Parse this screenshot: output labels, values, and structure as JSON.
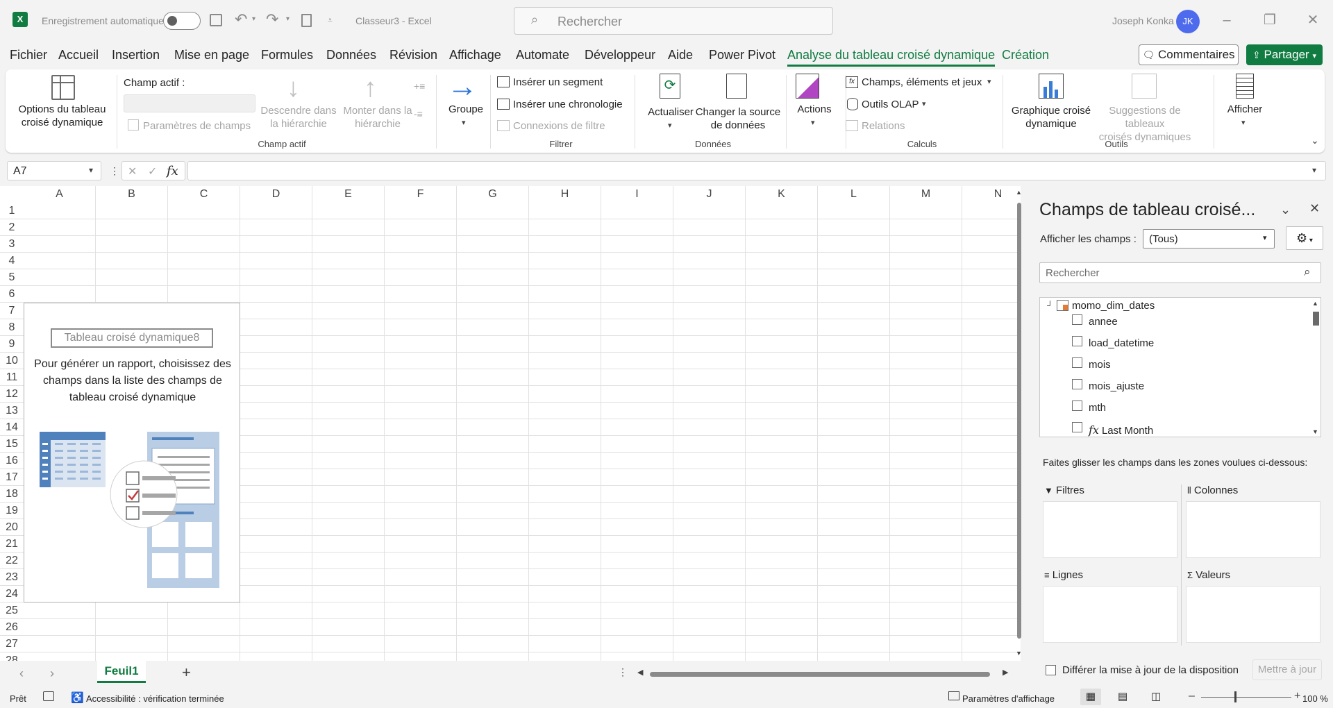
{
  "titlebar": {
    "autosave_label": "Enregistrement automatique",
    "doc_title": "Classeur3  -  Excel",
    "search_placeholder": "Rechercher",
    "user_name": "Joseph Konka",
    "user_initials": "JK"
  },
  "menu": {
    "items": [
      "Fichier",
      "Accueil",
      "Insertion",
      "Mise en page",
      "Formules",
      "Données",
      "Révision",
      "Affichage",
      "Automate",
      "Développeur",
      "Aide",
      "Power Pivot",
      "Analyse du tableau croisé dynamique",
      "Création"
    ],
    "active": "Analyse du tableau croisé dynamique",
    "comments_label": "Commentaires",
    "share_label": "Partager"
  },
  "ribbon": {
    "pivot_options": "Options du tableau\ncroisé dynamique",
    "active_field_label": "Champ actif :",
    "field_settings": "Paramètres de champs",
    "drill_down": "Descendre dans\nla hiérarchie",
    "drill_up": "Monter dans la\nhiérarchie",
    "group_active_field": "Champ actif",
    "group": "Groupe",
    "insert_slicer": "Insérer un segment",
    "insert_timeline": "Insérer une chronologie",
    "filter_connections": "Connexions de filtre",
    "group_filter": "Filtrer",
    "refresh": "Actualiser",
    "change_source": "Changer la source\nde données",
    "group_data": "Données",
    "actions": "Actions",
    "fields_items_sets": "Champs, éléments et jeux",
    "olap_tools": "Outils OLAP",
    "relations": "Relations",
    "group_calculations": "Calculs",
    "pivot_chart": "Graphique croisé\ndynamique",
    "suggestions": "Suggestions de tableaux\ncroisés dynamiques",
    "group_tools": "Outils",
    "show": "Afficher"
  },
  "formula": {
    "namebox": "A7",
    "fx": "fx",
    "value": ""
  },
  "sheet": {
    "columns": [
      "A",
      "B",
      "C",
      "D",
      "E",
      "F",
      "G",
      "H",
      "I",
      "J",
      "K",
      "L",
      "M",
      "N"
    ],
    "rows": [
      "1",
      "2",
      "3",
      "4",
      "5",
      "6",
      "7",
      "8",
      "9",
      "10",
      "11",
      "12",
      "13",
      "14",
      "15",
      "16",
      "17",
      "18",
      "19",
      "20",
      "21",
      "22",
      "23",
      "24",
      "25",
      "26",
      "27",
      "28"
    ],
    "pivot_name": "Tableau croisé dynamique8",
    "pivot_hint": "Pour générer un rapport, choisissez des champs dans la liste des champs de tableau croisé dynamique"
  },
  "tabs": {
    "sheets": [
      "Feuil1"
    ],
    "active": "Feuil1"
  },
  "status": {
    "ready": "Prêt",
    "accessibility": "Accessibilité : vérification terminée",
    "display_settings": "Paramètres d'affichage",
    "zoom": "100 %"
  },
  "taskpane": {
    "title": "Champs de tableau croisé...",
    "show_fields_label": "Afficher les champs :",
    "show_fields_value": "(Tous)",
    "search_placeholder": "Rechercher",
    "table_name": "momo_dim_dates",
    "fields": [
      {
        "name": "annee",
        "fx": false
      },
      {
        "name": "load_datetime",
        "fx": false
      },
      {
        "name": "mois",
        "fx": false
      },
      {
        "name": "mois_ajuste",
        "fx": false
      },
      {
        "name": "mth",
        "fx": false
      },
      {
        "name": "Last Month",
        "fx": true
      }
    ],
    "drag_hint": "Faites glisser les champs dans les zones voulues ci-dessous:",
    "zones": {
      "filters": "Filtres",
      "columns": "Colonnes",
      "rows": "Lignes",
      "values": "Valeurs"
    },
    "defer_label": "Différer la mise à jour de la disposition",
    "update_label": "Mettre à jour"
  },
  "colors": {
    "accent": "#107c41",
    "avatar": "#4f6bed",
    "pivot_blue": "#4f81bd"
  }
}
